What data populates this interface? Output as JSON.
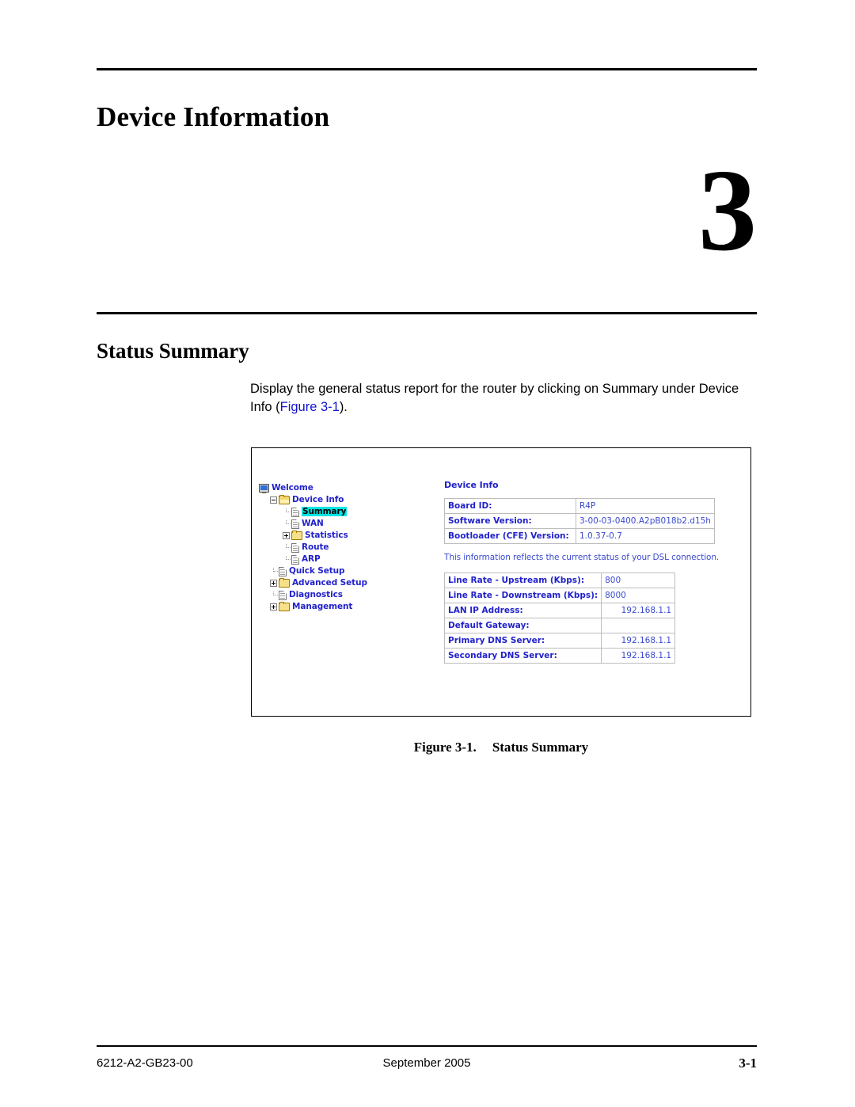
{
  "page": {
    "chapter_title": "Device Information",
    "chapter_number": "3",
    "section_heading": "Status Summary"
  },
  "body": {
    "paragraph_part1": "Display the general status report for the router by clicking on Summary under Device Info (",
    "paragraph_xref": "Figure 3-1",
    "paragraph_part2": ")."
  },
  "figure": {
    "caption_number": "Figure 3-1.",
    "caption_text": "Status Summary",
    "nav_tree": [
      {
        "label": "Welcome",
        "icon": "monitor-icon",
        "level": 0,
        "expander": "none",
        "selected": false
      },
      {
        "label": "Device Info",
        "icon": "folder-open-icon",
        "level": 1,
        "expander": "minus",
        "selected": false
      },
      {
        "label": "Summary",
        "icon": "page-icon",
        "level": 2,
        "expander": "leaf",
        "selected": true
      },
      {
        "label": "WAN",
        "icon": "page-icon",
        "level": 2,
        "expander": "leaf",
        "selected": false
      },
      {
        "label": "Statistics",
        "icon": "folder-icon",
        "level": 2,
        "expander": "plus",
        "selected": false
      },
      {
        "label": "Route",
        "icon": "page-icon",
        "level": 2,
        "expander": "leaf",
        "selected": false
      },
      {
        "label": "ARP",
        "icon": "page-icon",
        "level": 2,
        "expander": "leaf",
        "selected": false
      },
      {
        "label": "Quick Setup",
        "icon": "page-icon",
        "level": 1,
        "expander": "leaf",
        "selected": false
      },
      {
        "label": "Advanced Setup",
        "icon": "folder-icon",
        "level": 1,
        "expander": "plus",
        "selected": false
      },
      {
        "label": "Diagnostics",
        "icon": "page-icon",
        "level": 1,
        "expander": "leaf",
        "selected": false
      },
      {
        "label": "Management",
        "icon": "folder-icon",
        "level": 1,
        "expander": "plus",
        "selected": false
      }
    ],
    "panel": {
      "title": "Device Info",
      "device_table": [
        {
          "key": "Board ID:",
          "value": "R4P"
        },
        {
          "key": "Software Version:",
          "value": "3-00-03-0400.A2pB018b2.d15h"
        },
        {
          "key": "Bootloader (CFE) Version:",
          "value": "1.0.37-0.7"
        }
      ],
      "note": "This information reflects the current status of your DSL connection.",
      "status_table": [
        {
          "key": "Line Rate - Upstream (Kbps):",
          "value": "800",
          "align": "left"
        },
        {
          "key": "Line Rate - Downstream (Kbps):",
          "value": "8000",
          "align": "left"
        },
        {
          "key": "LAN IP Address:",
          "value": "192.168.1.1",
          "align": "right"
        },
        {
          "key": "Default Gateway:",
          "value": "",
          "align": "right"
        },
        {
          "key": "Primary DNS Server:",
          "value": "192.168.1.1",
          "align": "right"
        },
        {
          "key": "Secondary DNS Server:",
          "value": "192.168.1.1",
          "align": "right"
        }
      ]
    },
    "colors": {
      "link_blue": "#2222cc",
      "selection_cyan": "#00e5e5",
      "folder_yellow": "#f7e08a",
      "table_border": "#bdbdbd"
    }
  },
  "footer": {
    "doc_id": "6212-A2-GB23-00",
    "date": "September 2005",
    "page_number": "3-1"
  }
}
